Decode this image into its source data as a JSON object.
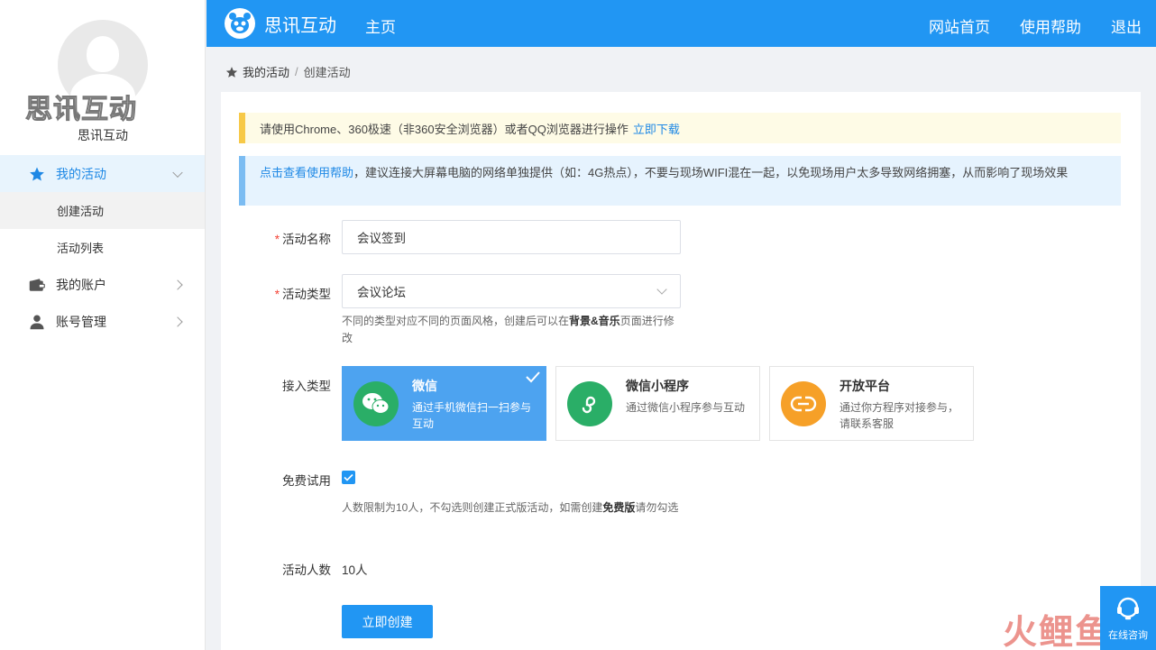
{
  "sidebar": {
    "brand_watermark": "思讯互动",
    "user_name": "思讯互动",
    "menu": [
      {
        "label": "我的活动",
        "icon": "star-icon",
        "active": true,
        "children": [
          {
            "label": "创建活动",
            "active": true
          },
          {
            "label": "活动列表",
            "active": false
          }
        ]
      },
      {
        "label": "我的账户",
        "icon": "wallet-icon"
      },
      {
        "label": "账号管理",
        "icon": "user-icon"
      }
    ]
  },
  "header": {
    "title": "思讯互动",
    "nav_home": "主页",
    "links": [
      "网站首页",
      "使用帮助",
      "退出"
    ],
    "color": "#2196f3"
  },
  "breadcrumb": {
    "root": "我的活动",
    "separator": "/",
    "current": "创建活动"
  },
  "notices": {
    "yellow_text": "请使用Chrome、360极速（非360安全浏览器）或者QQ浏览器进行操作",
    "yellow_link": "立即下载",
    "blue_link": "点击查看使用帮助",
    "blue_text": "，建议连接大屏幕电脑的网络单独提供（如：4G热点），不要与现场WIFI混在一起，以免现场用户太多导致网络拥塞，从而影响了现场效果"
  },
  "form": {
    "name": {
      "label": "活动名称",
      "value": "会议签到"
    },
    "type": {
      "label": "活动类型",
      "selected": "会议论坛",
      "hint_prefix": "不同的类型对应不同的页面风格，创建后可以在",
      "hint_bold": "背景&音乐",
      "hint_suffix": "页面进行修改"
    },
    "access": {
      "label": "接入类型",
      "options": [
        {
          "title": "微信",
          "desc": "通过手机微信扫一扫参与互动",
          "icon": "wechat-icon",
          "color": "#2aae67",
          "selected": true
        },
        {
          "title": "微信小程序",
          "desc": "通过微信小程序参与互动",
          "icon": "miniprogram-icon",
          "color": "#2aae67",
          "selected": false
        },
        {
          "title": "开放平台",
          "desc": "通过你方程序对接参与，请联系客服",
          "icon": "link-icon",
          "color": "#f6a028",
          "selected": false
        }
      ]
    },
    "trial": {
      "label": "免费试用",
      "checked": true,
      "hint_prefix": "人数限制为10人，不勾选则创建正式版活动，如需创建",
      "hint_bold": "免费版",
      "hint_suffix": "请勿勾选"
    },
    "count": {
      "label": "活动人数",
      "value": "10人"
    },
    "submit_label": "立即创建"
  },
  "consult": {
    "label": "在线咨询"
  },
  "watermark": "火鲤鱼"
}
